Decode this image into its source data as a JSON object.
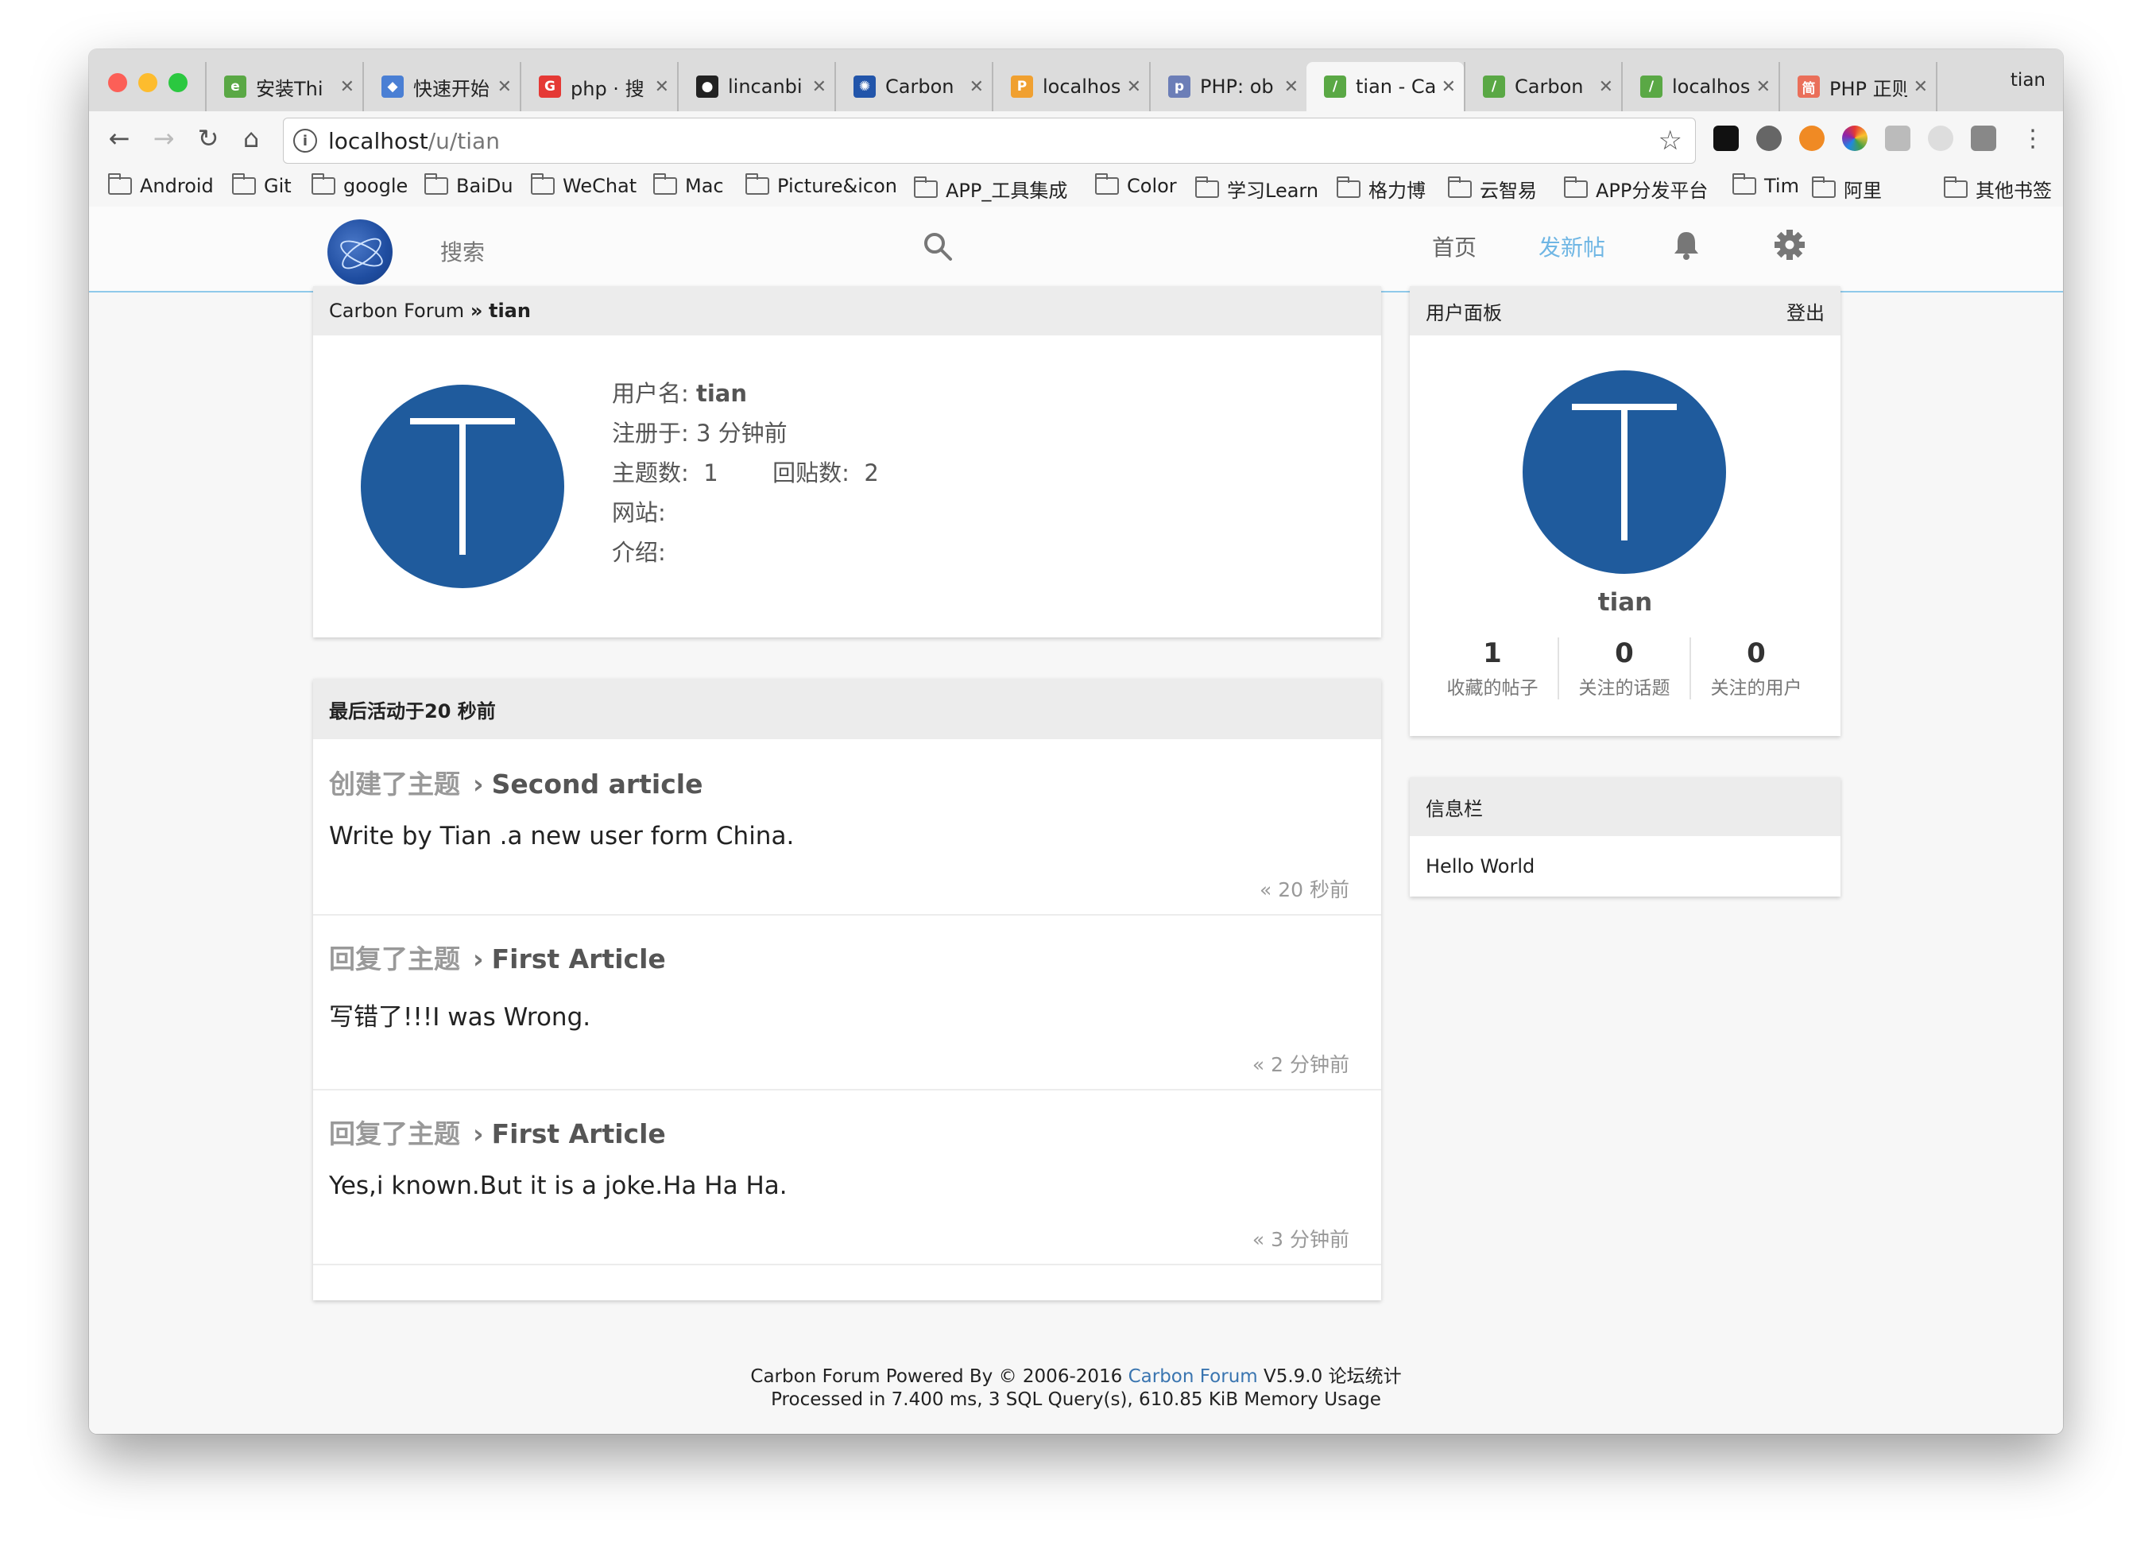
{
  "browser": {
    "tabs": [
      {
        "title": "安装Thi",
        "favicon_color": "#5aa845",
        "favicon_glyph": "e"
      },
      {
        "title": "快速开始",
        "favicon_color": "#4a7fd4",
        "favicon_glyph": "◆"
      },
      {
        "title": "php · 搜",
        "favicon_color": "#e53935",
        "favicon_glyph": "G"
      },
      {
        "title": "lincanbi",
        "favicon_color": "#222222",
        "favicon_glyph": "●"
      },
      {
        "title": "Carbon",
        "favicon_color": "#2255aa",
        "favicon_glyph": "✺"
      },
      {
        "title": "localhos",
        "favicon_color": "#f0a030",
        "favicon_glyph": "P"
      },
      {
        "title": "PHP: ob",
        "favicon_color": "#6c7eb7",
        "favicon_glyph": "p"
      },
      {
        "title": "tian - Ca",
        "favicon_color": "#5aa845",
        "favicon_glyph": "/"
      },
      {
        "title": "Carbon",
        "favicon_color": "#5aa845",
        "favicon_glyph": "/"
      },
      {
        "title": "localhos",
        "favicon_color": "#5aa845",
        "favicon_glyph": "/"
      },
      {
        "title": "PHP 正则",
        "favicon_color": "#ea6f5a",
        "favicon_glyph": "简"
      }
    ],
    "active_tab_index": 7,
    "profile": "tian",
    "url_host": "localhost",
    "url_path": "/u/tian",
    "bookmarks": [
      "Android",
      "Git",
      "google",
      "BaiDu",
      "WeChat",
      "Mac",
      "Picture&icon",
      "APP_工具集成",
      "Color",
      "学习Learn",
      "格力博",
      "云智易",
      "APP分发平台",
      "Tim",
      "阿里"
    ],
    "other_bookmarks": "其他书签"
  },
  "nav": {
    "search_label": "搜索",
    "home": "首页",
    "new_post": "发新帖"
  },
  "breadcrumb": {
    "site": "Carbon Forum",
    "sep": "»",
    "user": "tian"
  },
  "profile": {
    "avatar_letter": "T",
    "avatar_color": "#1f5b9d",
    "username_label": "用户名:",
    "username": "tian",
    "registered_label": "注册于:",
    "registered": "3 分钟前",
    "topics_label": "主题数:",
    "topics": "1",
    "replies_label": "回贴数:",
    "replies": "2",
    "website_label": "网站:",
    "intro_label": "介绍:"
  },
  "activity": {
    "header": "最后活动于20 秒前",
    "items": [
      {
        "type": "创建了主题",
        "title": "Second article",
        "body": "Write by Tian .a new user form China.",
        "time": "«  20 秒前"
      },
      {
        "type": "回复了主题",
        "title": "First Article",
        "body": "写错了!!!I was Wrong.",
        "time": "«  2 分钟前"
      },
      {
        "type": "回复了主题",
        "title": "First Article",
        "body": "Yes,i known.But it is a joke.Ha Ha Ha.",
        "time": "«  3 分钟前"
      }
    ]
  },
  "user_panel": {
    "title": "用户面板",
    "logout": "登出",
    "username": "tian",
    "stats": [
      {
        "value": "1",
        "label": "收藏的帖子"
      },
      {
        "value": "0",
        "label": "关注的话题"
      },
      {
        "value": "0",
        "label": "关注的用户"
      }
    ]
  },
  "info_panel": {
    "title": "信息栏",
    "content": "Hello World"
  },
  "footer": {
    "line1_prefix": "Carbon Forum Powered By © 2006-2016 ",
    "line1_link": "Carbon Forum",
    "line1_suffix": " V5.9.0 ",
    "stats_link": "论坛统计",
    "line2": "Processed in 7.400 ms, 3 SQL Query(s), 610.85 KiB Memory Usage"
  },
  "colors": {
    "accent": "#6fb6e4",
    "avatar": "#1f5b9d",
    "link": "#3a75b0"
  }
}
